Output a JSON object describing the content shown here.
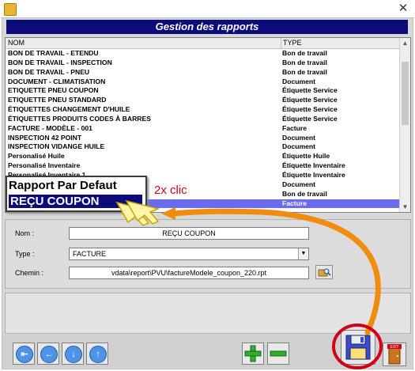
{
  "window": {
    "close_glyph": "✕"
  },
  "header": {
    "title": "Gestion des rapports"
  },
  "grid": {
    "columns": [
      "NOM",
      "TYPE"
    ],
    "rows": [
      {
        "nom": "BON DE TRAVAIL - ETENDU",
        "type": "Bon de travail"
      },
      {
        "nom": "BON DE TRAVAIL - INSPECTION",
        "type": "Bon de travail"
      },
      {
        "nom": "BON DE TRAVAIL - PNEU",
        "type": "Bon de travail"
      },
      {
        "nom": "DOCUMENT - CLIMATISATION",
        "type": "Document"
      },
      {
        "nom": "ETIQUETTE PNEU COUPON",
        "type": "Étiquette Service"
      },
      {
        "nom": "ETIQUETTE PNEU STANDARD",
        "type": "Étiquette Service"
      },
      {
        "nom": "ÉTIQUETTES CHANGEMENT D'HUILE",
        "type": "Étiquette Service"
      },
      {
        "nom": "ÉTIQUETTES PRODUITS CODES À BARRES",
        "type": "Étiquette Service"
      },
      {
        "nom": "FACTURE - MODÈLE - 001",
        "type": "Facture"
      },
      {
        "nom": "INSPECTION 42 POINT",
        "type": "Document"
      },
      {
        "nom": "INSPECTION VIDANGE HUILE",
        "type": "Document"
      },
      {
        "nom": "Personalisé Huile",
        "type": "Étiquette Huile"
      },
      {
        "nom": "Personalisé Inventaire",
        "type": "Étiquette Inventaire"
      },
      {
        "nom": "Personalisé Inventaire 1",
        "type": "Étiquette Inventaire"
      },
      {
        "nom": "",
        "type": "Document"
      },
      {
        "nom": "",
        "type": "Bon de travail"
      },
      {
        "nom": "",
        "type": "Facture"
      }
    ],
    "selected_index": 16
  },
  "context_menu": {
    "items": [
      "Rapport Par Defaut",
      "REÇU COUPON"
    ]
  },
  "annotation": {
    "text": "2x clic",
    "color": "#d0001a"
  },
  "form": {
    "nom_label": "Nom :",
    "nom_value": "REÇU COUPON",
    "type_label": "Type :",
    "type_value": "FACTURE",
    "chemin_label": "Chemin :",
    "chemin_value": "vdata\\report\\PVU\\factureModele_coupon_220.rpt"
  },
  "toolbar": {
    "nav_icons": [
      "first-record-icon",
      "previous-record-icon",
      "next-record-icon",
      "last-record-icon"
    ],
    "add_icon": "plus-icon",
    "remove_icon": "minus-icon",
    "save_icon": "floppy-disk-icon",
    "exit_label": "EXIT"
  },
  "colors": {
    "header_bg": "#0b0b7a",
    "selection_bg": "#6b6bf0",
    "arrow": "#f28c0f",
    "highlight_circle": "#d0001a",
    "add_green": "#2fae2f"
  }
}
